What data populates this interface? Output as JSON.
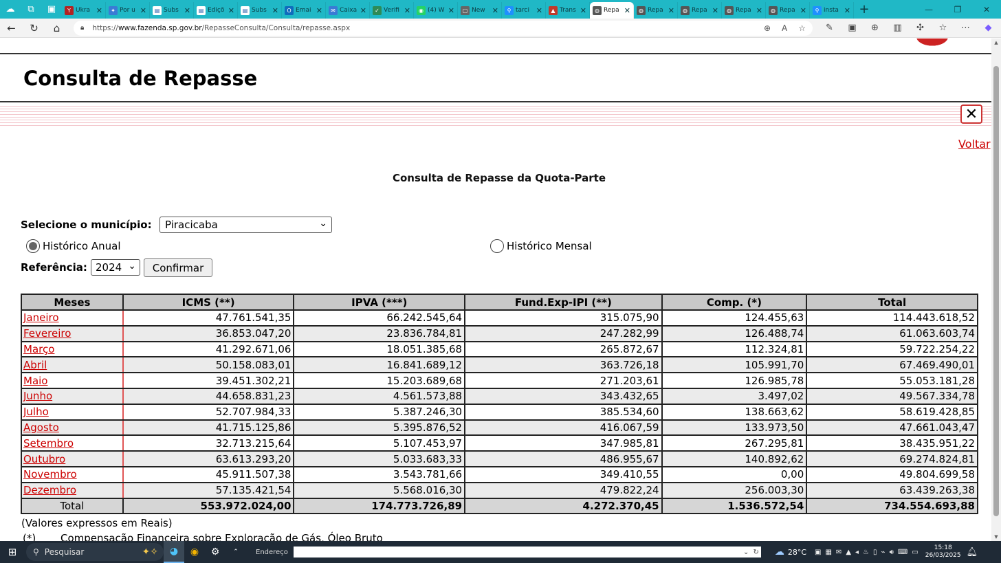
{
  "browser": {
    "tabs": [
      {
        "label": "Ukra",
        "color": "#b22222",
        "glyph": "Y"
      },
      {
        "label": "Por u",
        "color": "#3a7bd5",
        "glyph": "✦"
      },
      {
        "label": "Subs",
        "color": "#ffffff",
        "glyph": "▤"
      },
      {
        "label": "Ediçõ",
        "color": "#ffffff",
        "glyph": "▤"
      },
      {
        "label": "Subs",
        "color": "#ffffff",
        "glyph": "▤"
      },
      {
        "label": "Emai",
        "color": "#0f6cbd",
        "glyph": "O"
      },
      {
        "label": "Caixa",
        "color": "#3a7bd5",
        "glyph": "✉"
      },
      {
        "label": "Verifi",
        "color": "#2e8b57",
        "glyph": "✓"
      },
      {
        "label": "(4) W",
        "color": "#25d366",
        "glyph": "◉"
      },
      {
        "label": "New",
        "color": "#666666",
        "glyph": "▢"
      },
      {
        "label": "tarci",
        "color": "#1e90ff",
        "glyph": "⚲"
      },
      {
        "label": "Trans",
        "color": "#c0392b",
        "glyph": "▲"
      },
      {
        "label": "Repa",
        "color": "#555555",
        "glyph": "◍"
      },
      {
        "label": "Repa",
        "color": "#555555",
        "glyph": "◍"
      },
      {
        "label": "Repa",
        "color": "#555555",
        "glyph": "◍"
      },
      {
        "label": "Repa",
        "color": "#555555",
        "glyph": "◍"
      },
      {
        "label": "Repa",
        "color": "#555555",
        "glyph": "◍"
      },
      {
        "label": "insta",
        "color": "#1e90ff",
        "glyph": "⚲"
      }
    ],
    "active_tab_index": 12,
    "url_prefix": "https://",
    "url_host": "www.fazenda.sp.gov.br",
    "url_path": "/RepasseConsulta/Consulta/repasse.aspx"
  },
  "page": {
    "heading": "Consulta de Repasse",
    "close_glyph": "✕",
    "back_link": "Voltar",
    "subtitle": "Consulta de Repasse da Quota-Parte",
    "municipality_label": "Selecione o município:",
    "municipality_value": "Piracicaba",
    "radio_annual": "Histórico Anual",
    "radio_monthly": "Histórico Mensal",
    "radio_annual_checked": true,
    "reference_label": "Referência:",
    "reference_year": "2024",
    "confirm_button": "Confirmar",
    "table": {
      "headers": [
        "Meses",
        "ICMS (**)",
        "IPVA (***)",
        "Fund.Exp-IPI (**)",
        "Comp. (*)",
        "Total"
      ],
      "rows": [
        [
          "Janeiro",
          "47.761.541,35",
          "66.242.545,64",
          "315.075,90",
          "124.455,63",
          "114.443.618,52"
        ],
        [
          "Fevereiro",
          "36.853.047,20",
          "23.836.784,81",
          "247.282,99",
          "126.488,74",
          "61.063.603,74"
        ],
        [
          "Março",
          "41.292.671,06",
          "18.051.385,68",
          "265.872,67",
          "112.324,81",
          "59.722.254,22"
        ],
        [
          "Abril",
          "50.158.083,01",
          "16.841.689,12",
          "363.726,18",
          "105.991,70",
          "67.469.490,01"
        ],
        [
          "Maio",
          "39.451.302,21",
          "15.203.689,68",
          "271.203,61",
          "126.985,78",
          "55.053.181,28"
        ],
        [
          "Junho",
          "44.658.831,23",
          "4.561.573,88",
          "343.432,65",
          "3.497,02",
          "49.567.334,78"
        ],
        [
          "Julho",
          "52.707.984,33",
          "5.387.246,30",
          "385.534,60",
          "138.663,62",
          "58.619.428,85"
        ],
        [
          "Agosto",
          "41.715.125,86",
          "5.395.876,52",
          "416.067,59",
          "133.973,50",
          "47.661.043,47"
        ],
        [
          "Setembro",
          "32.713.215,64",
          "5.107.453,97",
          "347.985,81",
          "267.295,81",
          "38.435.951,22"
        ],
        [
          "Outubro",
          "63.613.293,20",
          "5.033.683,33",
          "486.955,67",
          "140.892,62",
          "69.274.824,81"
        ],
        [
          "Novembro",
          "45.911.507,38",
          "3.543.781,66",
          "349.410,55",
          "0,00",
          "49.804.699,58"
        ],
        [
          "Dezembro",
          "57.135.421,54",
          "5.568.016,30",
          "479.822,24",
          "256.003,30",
          "63.439.263,38"
        ]
      ],
      "total_row": [
        "Total",
        "553.972.024,00",
        "174.773.726,89",
        "4.272.370,45",
        "1.536.572,54",
        "734.554.693,88"
      ]
    },
    "note_values": "(Valores expressos em Reais)",
    "note_star_mark": "(*)",
    "note_star_text": "Compensação Financeira sobre Exploração de Gás, Óleo Bruto"
  },
  "taskbar": {
    "search_placeholder": "Pesquisar",
    "address_label": "Endereço",
    "temperature": "28°C",
    "time": "15:18",
    "date": "26/03/2025"
  }
}
